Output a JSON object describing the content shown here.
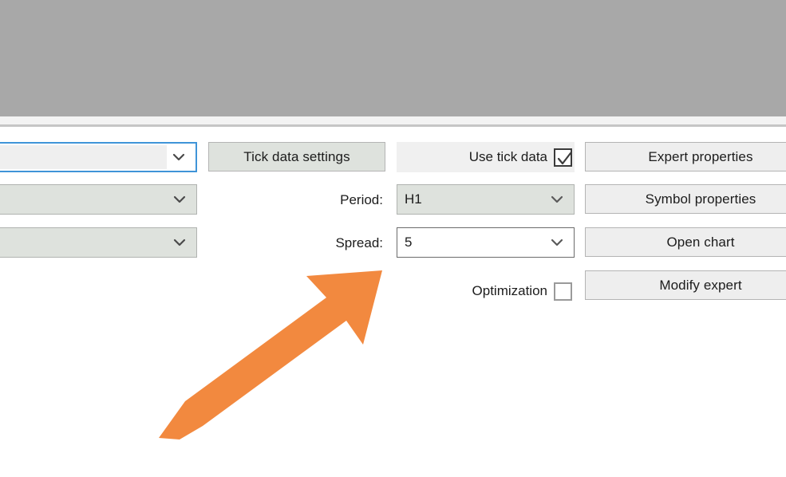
{
  "window": {
    "top_panel_color": "#a8a8a8",
    "background_color": "#ffffff",
    "divider_color": "#c6c6c6"
  },
  "form": {
    "left_combos": [
      {
        "name": "expert-advisor-combo",
        "value": "",
        "state": "focused",
        "icon": "chevron-down-icon"
      },
      {
        "name": "symbol-combo",
        "value": "",
        "state": "normal",
        "icon": "chevron-down-icon"
      },
      {
        "name": "model-combo",
        "value": "",
        "state": "normal",
        "icon": "chevron-down-icon"
      }
    ],
    "tick_data_settings_button": "Tick data settings",
    "use_tick_data": {
      "label": "Use tick data",
      "checked": true,
      "icon": "check-icon"
    },
    "period": {
      "label": "Period:",
      "value": "H1",
      "icon": "chevron-down-icon"
    },
    "spread": {
      "label": "Spread:",
      "value": "5",
      "icon": "chevron-down-icon"
    },
    "optimization": {
      "label": "Optimization",
      "checked": false
    },
    "right_buttons": [
      {
        "name": "expert-properties-button",
        "label": "Expert properties"
      },
      {
        "name": "symbol-properties-button",
        "label": "Symbol properties"
      },
      {
        "name": "open-chart-button",
        "label": "Open chart"
      },
      {
        "name": "modify-expert-button",
        "label": "Modify expert"
      }
    ]
  },
  "annotation": {
    "arrow": {
      "name": "orange-arrow-annotation",
      "color": "#F2893F",
      "direction": "up-right",
      "points_at": "Spread field"
    }
  }
}
